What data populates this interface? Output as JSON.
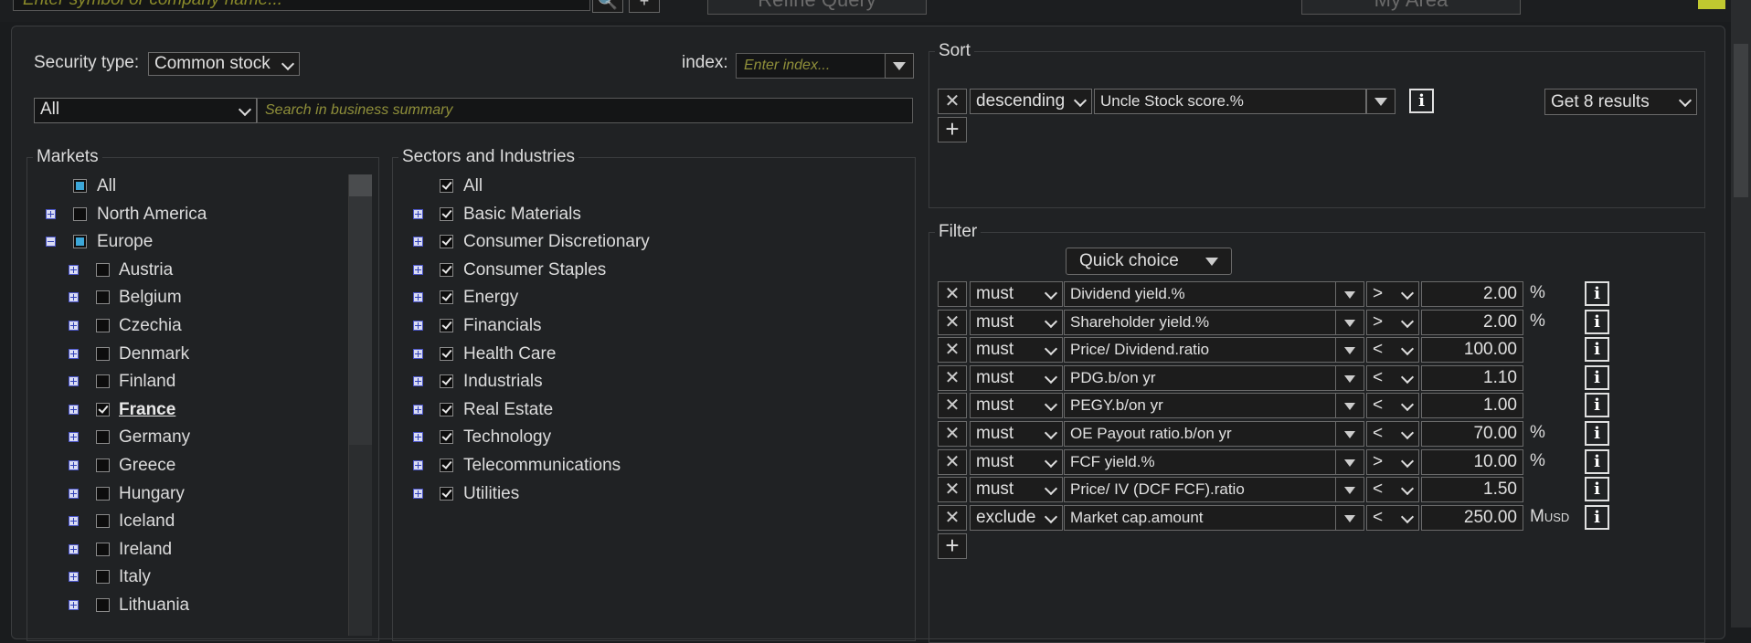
{
  "topbar": {
    "symbol_placeholder": "Enter symbol or company name...",
    "search_glyph": "🔍",
    "add_glyph": "+",
    "refine_label": "Refine Query",
    "myarea_label": "My Area"
  },
  "security": {
    "label": "Security type:",
    "value": "Common stock",
    "index_label": "index:",
    "index_placeholder": "Enter index...",
    "scope_value": "All",
    "summary_placeholder": "Search in business summary"
  },
  "markets": {
    "title": "Markets",
    "items": [
      {
        "label": "All",
        "state": "partial",
        "expander": "none",
        "level": 0
      },
      {
        "label": "North America",
        "state": "unchecked",
        "expander": "plus",
        "level": 0
      },
      {
        "label": "Europe",
        "state": "partial",
        "expander": "minus",
        "level": 0
      },
      {
        "label": "Austria",
        "state": "unchecked",
        "expander": "plus",
        "level": 1
      },
      {
        "label": "Belgium",
        "state": "unchecked",
        "expander": "plus",
        "level": 1
      },
      {
        "label": "Czechia",
        "state": "unchecked",
        "expander": "plus",
        "level": 1
      },
      {
        "label": "Denmark",
        "state": "unchecked",
        "expander": "plus",
        "level": 1
      },
      {
        "label": "Finland",
        "state": "unchecked",
        "expander": "plus",
        "level": 1
      },
      {
        "label": "France",
        "state": "checked",
        "expander": "plus",
        "level": 1
      },
      {
        "label": "Germany",
        "state": "unchecked",
        "expander": "plus",
        "level": 1
      },
      {
        "label": "Greece",
        "state": "unchecked",
        "expander": "plus",
        "level": 1
      },
      {
        "label": "Hungary",
        "state": "unchecked",
        "expander": "plus",
        "level": 1
      },
      {
        "label": "Iceland",
        "state": "unchecked",
        "expander": "plus",
        "level": 1
      },
      {
        "label": "Ireland",
        "state": "unchecked",
        "expander": "plus",
        "level": 1
      },
      {
        "label": "Italy",
        "state": "unchecked",
        "expander": "plus",
        "level": 1
      },
      {
        "label": "Lithuania",
        "state": "unchecked",
        "expander": "plus",
        "level": 1
      }
    ]
  },
  "sectors": {
    "title": "Sectors and Industries",
    "items": [
      {
        "label": "All",
        "expander": "none"
      },
      {
        "label": "Basic Materials",
        "expander": "plus"
      },
      {
        "label": "Consumer Discretionary",
        "expander": "plus"
      },
      {
        "label": "Consumer Staples",
        "expander": "plus"
      },
      {
        "label": "Energy",
        "expander": "plus"
      },
      {
        "label": "Financials",
        "expander": "plus"
      },
      {
        "label": "Health Care",
        "expander": "plus"
      },
      {
        "label": "Industrials",
        "expander": "plus"
      },
      {
        "label": "Real Estate",
        "expander": "plus"
      },
      {
        "label": "Technology",
        "expander": "plus"
      },
      {
        "label": "Telecommunications",
        "expander": "plus"
      },
      {
        "label": "Utilities",
        "expander": "plus"
      }
    ]
  },
  "sort": {
    "title": "Sort",
    "direction": "descending",
    "field": "Uncle Stock score.%",
    "results": "Get 8 results"
  },
  "filter": {
    "title": "Filter",
    "quick_choice": "Quick choice",
    "rows": [
      {
        "mode": "must",
        "field": "Dividend yield.%",
        "op": ">",
        "value": "2.00",
        "unit": "%",
        "unit_sub": ""
      },
      {
        "mode": "must",
        "field": "Shareholder yield.%",
        "op": ">",
        "value": "2.00",
        "unit": "%",
        "unit_sub": ""
      },
      {
        "mode": "must",
        "field": "Price/ Dividend.ratio",
        "op": "<",
        "value": "100.00",
        "unit": "",
        "unit_sub": ""
      },
      {
        "mode": "must",
        "field": "PDG.b/on yr",
        "op": "<",
        "value": "1.10",
        "unit": "",
        "unit_sub": ""
      },
      {
        "mode": "must",
        "field": "PEGY.b/on yr",
        "op": "<",
        "value": "1.00",
        "unit": "",
        "unit_sub": ""
      },
      {
        "mode": "must",
        "field": "OE Payout ratio.b/on yr",
        "op": "<",
        "value": "70.00",
        "unit": "%",
        "unit_sub": ""
      },
      {
        "mode": "must",
        "field": "FCF yield.%",
        "op": ">",
        "value": "10.00",
        "unit": "%",
        "unit_sub": ""
      },
      {
        "mode": "must",
        "field": "Price/ IV (DCF FCF).ratio",
        "op": "<",
        "value": "1.50",
        "unit": "",
        "unit_sub": ""
      },
      {
        "mode": "exclude",
        "field": "Market cap.amount",
        "op": "<",
        "value": "250.00",
        "unit": "M",
        "unit_sub": "USD"
      }
    ]
  },
  "glyphs": {
    "remove": "✕",
    "add": "+",
    "info": "i"
  },
  "colors": {
    "background": "#1a1c1e",
    "panel": "#202224",
    "placeholder": "#8f8f3a",
    "accent": "#3ca7d8"
  }
}
